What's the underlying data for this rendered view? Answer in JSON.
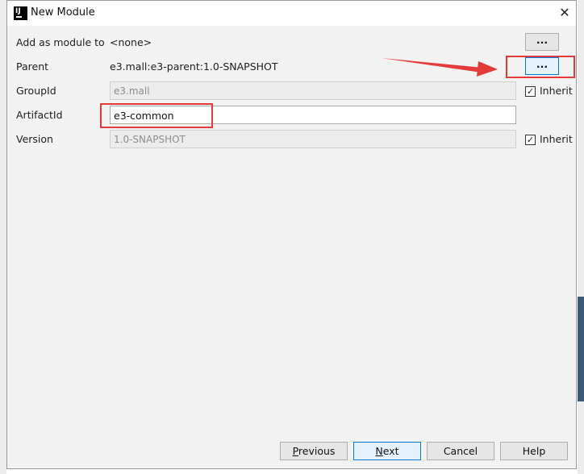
{
  "dialog": {
    "title": "New Module",
    "close_icon": "close-icon"
  },
  "form": {
    "add_as_module": {
      "label": "Add as module to",
      "value": "<none>",
      "button": "..."
    },
    "parent": {
      "label": "Parent",
      "value": "e3.mall:e3-parent:1.0-SNAPSHOT",
      "button": "..."
    },
    "group_id": {
      "label": "GroupId",
      "value": "e3.mall",
      "inherit_label": "Inherit",
      "inherit_checked": "✓"
    },
    "artifact_id": {
      "label": "ArtifactId",
      "value": "e3-common"
    },
    "version": {
      "label": "Version",
      "value": "1.0-SNAPSHOT",
      "inherit_label": "Inherit",
      "inherit_checked": "✓"
    }
  },
  "footer": {
    "previous_rest": "revious",
    "previous_first": "P",
    "next_first": "N",
    "next_rest": "ext",
    "cancel": "Cancel",
    "help": "Help"
  },
  "colors": {
    "annotation_red": "#e53a3a",
    "focus_blue": "#0078d7"
  }
}
